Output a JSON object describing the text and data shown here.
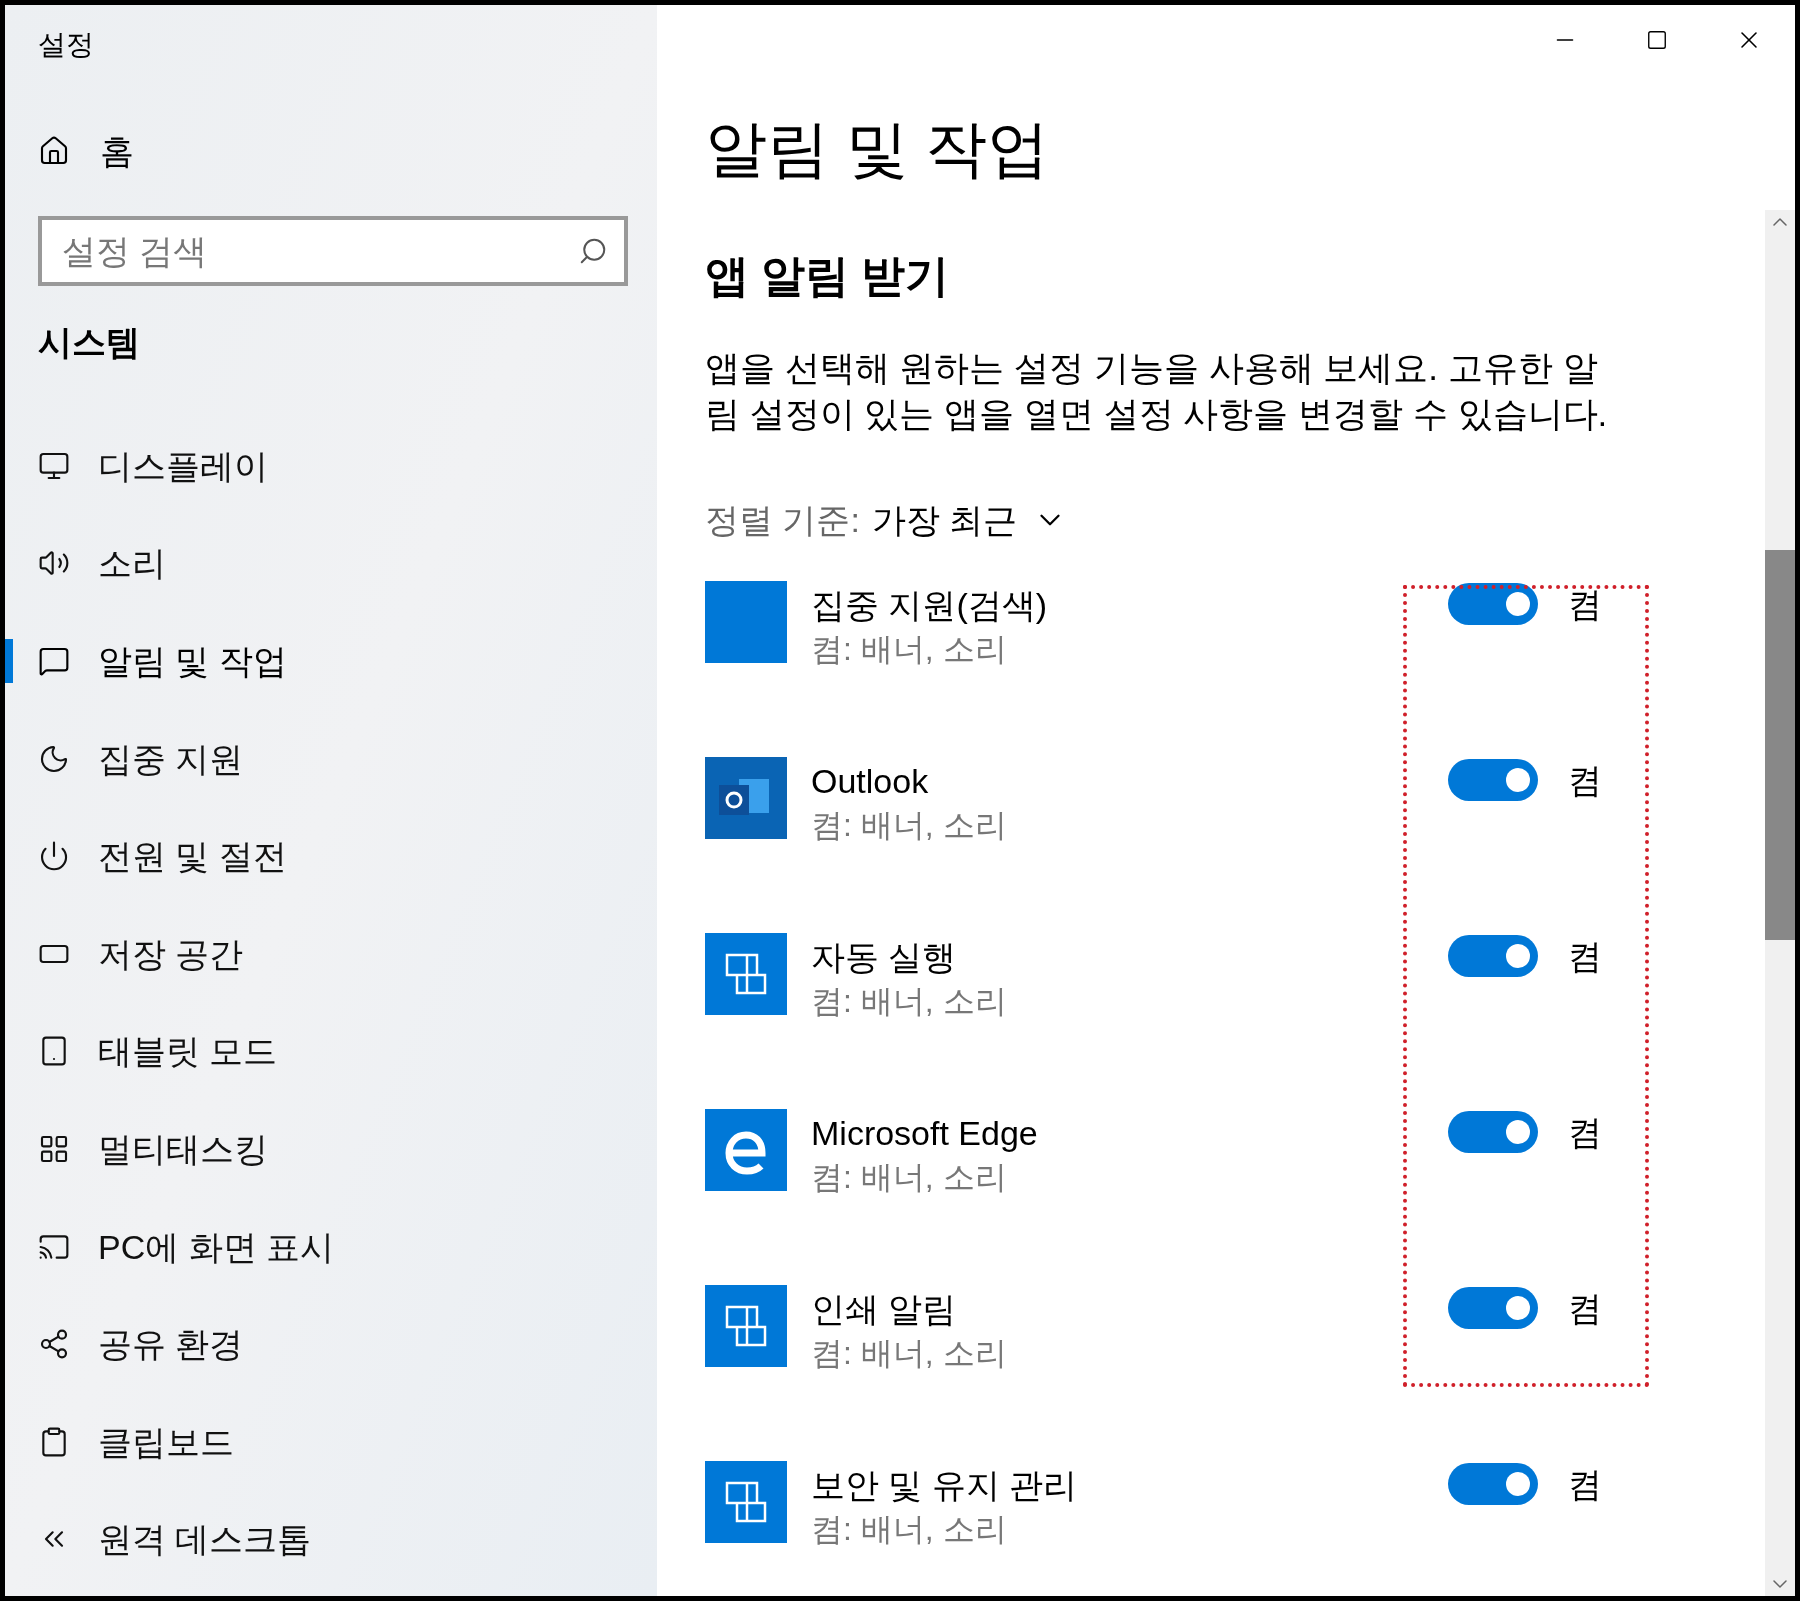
{
  "window": {
    "title": "설정"
  },
  "sidebar": {
    "home": "홈",
    "search": {
      "placeholder": "설정 검색"
    },
    "section": "시스템",
    "items": [
      {
        "label": "디스플레이",
        "kind": "display",
        "selected": false
      },
      {
        "label": "소리",
        "kind": "sound",
        "selected": false
      },
      {
        "label": "알림 및 작업",
        "kind": "notifications",
        "selected": true
      },
      {
        "label": "집중 지원",
        "kind": "focus",
        "selected": false
      },
      {
        "label": "전원 및 절전",
        "kind": "power",
        "selected": false
      },
      {
        "label": "저장 공간",
        "kind": "storage",
        "selected": false
      },
      {
        "label": "태블릿 모드",
        "kind": "tablet",
        "selected": false
      },
      {
        "label": "멀티태스킹",
        "kind": "multitasking",
        "selected": false
      },
      {
        "label": "PC에 화면 표시",
        "kind": "project",
        "selected": false
      },
      {
        "label": "공유 환경",
        "kind": "shared",
        "selected": false
      },
      {
        "label": "클립보드",
        "kind": "clipboard",
        "selected": false
      },
      {
        "label": "원격 데스크톱",
        "kind": "remote",
        "selected": false
      }
    ]
  },
  "main": {
    "title": "알림 및 작업",
    "section_title": "앱 알림 받기",
    "description": "앱을 선택해 원하는 설정 기능을 사용해 보세요. 고유한 알림 설정이 있는 앱을 열면 설정 사항을 변경할 수 있습니다.",
    "sort": {
      "label": "정렬 기준:",
      "value": "가장 최근"
    },
    "apps": [
      {
        "name": "집중 지원(검색)",
        "status": "켬: 배너, 소리",
        "kind": "blank",
        "on": true,
        "state_label": "켬"
      },
      {
        "name": "Outlook",
        "status": "켬: 배너, 소리",
        "kind": "outlook",
        "on": true,
        "state_label": "켬"
      },
      {
        "name": "자동 실행",
        "status": "켬: 배너, 소리",
        "kind": "generic",
        "on": true,
        "state_label": "켬"
      },
      {
        "name": "Microsoft Edge",
        "status": "켬: 배너, 소리",
        "kind": "edge",
        "on": true,
        "state_label": "켬"
      },
      {
        "name": "인쇄 알림",
        "status": "켬: 배너, 소리",
        "kind": "generic",
        "on": true,
        "state_label": "켬"
      },
      {
        "name": "보안 및 유지 관리",
        "status": "켬: 배너, 소리",
        "kind": "generic",
        "on": true,
        "state_label": "켬"
      }
    ]
  }
}
